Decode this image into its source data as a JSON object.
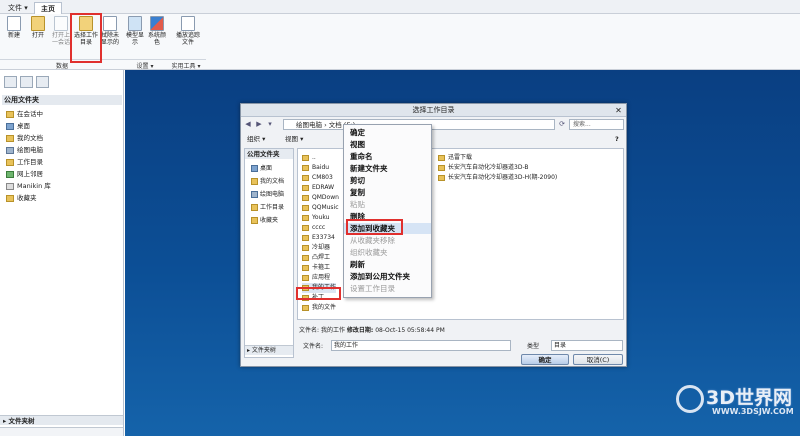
{
  "tabs": {
    "file": "文件 ▾",
    "home": "主页"
  },
  "ribbon": {
    "buttons": [
      {
        "label": "新建"
      },
      {
        "label": "打开"
      },
      {
        "label": "打开上一会话"
      },
      {
        "label": "选择工作目录"
      },
      {
        "label": "拭除未显示的"
      },
      {
        "label": "模型显示"
      },
      {
        "label": "系统颜色"
      },
      {
        "label": "播放追踪文件"
      }
    ],
    "groups": {
      "data": "数据",
      "settings": "设置 ▾",
      "utilities": "实用工具 ▾"
    }
  },
  "left_panel": {
    "header": "公用文件夹",
    "items": [
      "在会话中",
      "桌面",
      "我的文档",
      "绘图电脑",
      "工作目录",
      "网上邻居",
      "Manikin 库",
      "收藏夹"
    ],
    "footer": "▸ 文件夹树"
  },
  "dialog": {
    "title": "选择工作目录",
    "close": "✕",
    "address": "绘图电脑 › 文档 (E:) ›",
    "search_placeholder": "搜索...",
    "toolbar": {
      "organize": "组织 ▾",
      "view": "视图 ▾",
      "help": "?"
    },
    "fav_header": "公用文件夹",
    "favorites": [
      "桌面",
      "我的文档",
      "绘图电脑",
      "工作目录",
      "收藏夹"
    ],
    "tree_label": "▸ 文件夹树",
    "files_left": [
      "..",
      "Baidu",
      "CM803",
      "EDRAW",
      "QMDown",
      "QQMusic",
      "Youku",
      "cccc",
      "E33734",
      "冷却器",
      "凸焊工",
      "卡箍工",
      "应用程",
      "我的工作",
      "补丁",
      "我的文件"
    ],
    "files_right": [
      "迅雷下载",
      "长安汽车自动化冷却器道3D-B",
      "长安汽车自动化冷却器道3D-H(期-2090)"
    ],
    "info_label": "文件名:",
    "info_name": "我的工作",
    "info_date_label": "修改日期:",
    "info_date": "08-Oct-15 05:58:44 PM",
    "filename_label": "文件名:",
    "filename_value": "我的工作",
    "type_label": "类型",
    "type_value": "目录",
    "ok": "确定",
    "cancel": "取消(C)"
  },
  "context_menu": {
    "items": [
      {
        "label": "确定",
        "enabled": true
      },
      {
        "label": "视图",
        "enabled": true
      },
      {
        "label": "重命名",
        "enabled": true
      },
      {
        "label": "新建文件夹",
        "enabled": true
      },
      {
        "label": "剪切",
        "enabled": true
      },
      {
        "label": "复制",
        "enabled": true
      },
      {
        "label": "粘贴",
        "enabled": false
      },
      {
        "label": "删除",
        "enabled": true
      },
      {
        "label": "添加到收藏夹",
        "enabled": true
      },
      {
        "label": "从收藏夹移除",
        "enabled": false
      },
      {
        "label": "组织收藏夹",
        "enabled": false
      },
      {
        "label": "刷新",
        "enabled": true
      },
      {
        "label": "添加到公用文件夹",
        "enabled": true
      },
      {
        "label": "设置工作目录",
        "enabled": false
      }
    ]
  },
  "watermark": {
    "title": "3D世界网",
    "url": "WWW.3DSJW.COM"
  },
  "colors": {
    "graphics_bg": "#0c4f96",
    "highlight": "#e0302e"
  }
}
